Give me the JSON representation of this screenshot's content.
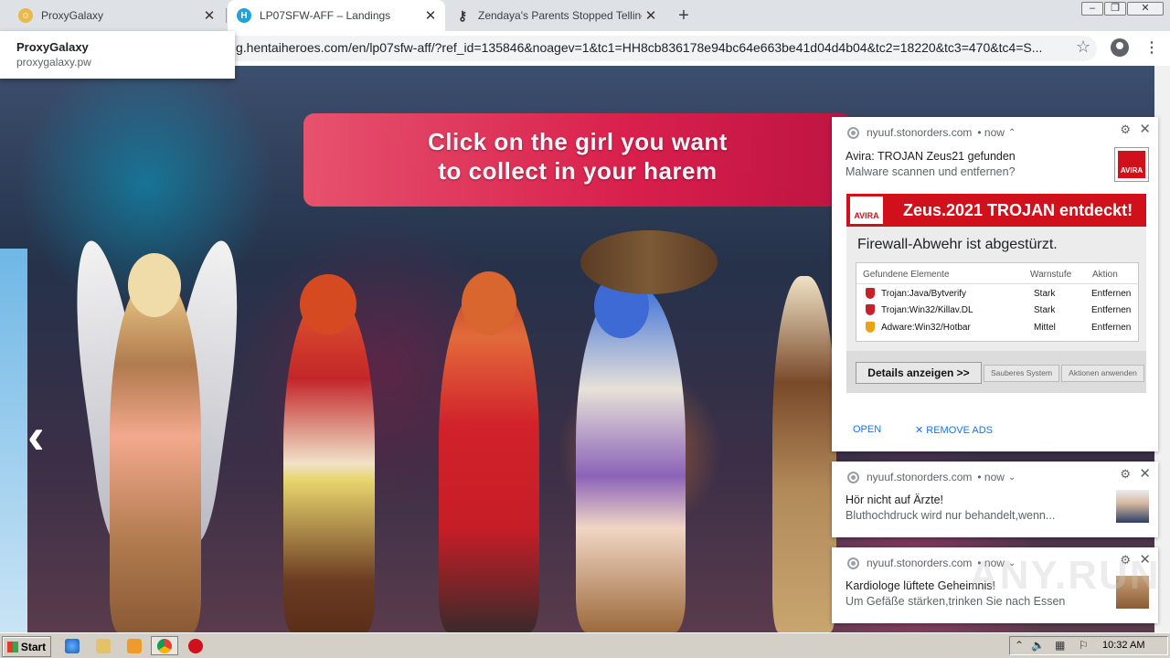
{
  "browser": {
    "tabs": [
      {
        "title": "ProxyGalaxy",
        "favicon": "proxygalaxy-favicon",
        "active": false
      },
      {
        "title": "LP07SFW-AFF – Landings",
        "favicon": "hentaiheroes-favicon",
        "active": true
      },
      {
        "title": "Zendaya's Parents Stopped Telling H",
        "favicon": "key-favicon",
        "active": false
      }
    ],
    "url": "g.hentaiheroes.com/en/lp07sfw-aff/?ref_id=135846&noagev=1&tc1=HH8cb836178e94bc64e663be41d04d4b04&tc2=18220&tc3=470&tc4=S...",
    "hovercard": {
      "title": "ProxyGalaxy",
      "subtitle": "proxygalaxy.pw"
    }
  },
  "page": {
    "banner_line1": "Click on the girl you want",
    "banner_line2": "to collect in your harem",
    "prev_arrow": "‹"
  },
  "notifications": [
    {
      "source": "nyuuf.stonorders.com",
      "time": "• now",
      "title": "Avira: TROJAN Zeus21 gefunden",
      "message": "Malware scannen und entfernen?",
      "thumb_icon": "avira-icon",
      "ad": {
        "logo": "AVIRA",
        "heading": "Zeus.2021 TROJAN entdeckt!",
        "subheading": "Firewall-Abwehr ist abgestürzt.",
        "columns": [
          "Gefundene Elemente",
          "Warnstufe",
          "Aktion"
        ],
        "rows": [
          {
            "name": "Trojan:Java/Bytverify",
            "level": "Stark",
            "action": "Entfernen",
            "color": "#c8202a"
          },
          {
            "name": "Trojan:Win32/Killav.DL",
            "level": "Stark",
            "action": "Entfernen",
            "color": "#c8202a"
          },
          {
            "name": "Adware:Win32/Hotbar",
            "level": "Mittel",
            "action": "Entfernen",
            "color": "#e8a317"
          }
        ],
        "btn_details": "Details anzeigen >>",
        "btn_clean": "Sauberes System",
        "btn_apply": "Aktionen anwenden"
      },
      "action_open": "OPEN",
      "action_remove": "REMOVE ADS"
    },
    {
      "source": "nyuuf.stonorders.com",
      "time": "• now",
      "title": "Hör nicht auf Ärzte!",
      "message": "Bluthochdruck wird nur behandelt,wenn..."
    },
    {
      "source": "nyuuf.stonorders.com",
      "time": "• now",
      "title": "Kardiologe lüftete Geheimnis!",
      "message": "Um Gefäße stärken,trinken Sie nach Essen"
    }
  ],
  "taskbar": {
    "start_label": "Start",
    "clock": "10:32 AM"
  },
  "watermark": "ANY.RUN"
}
